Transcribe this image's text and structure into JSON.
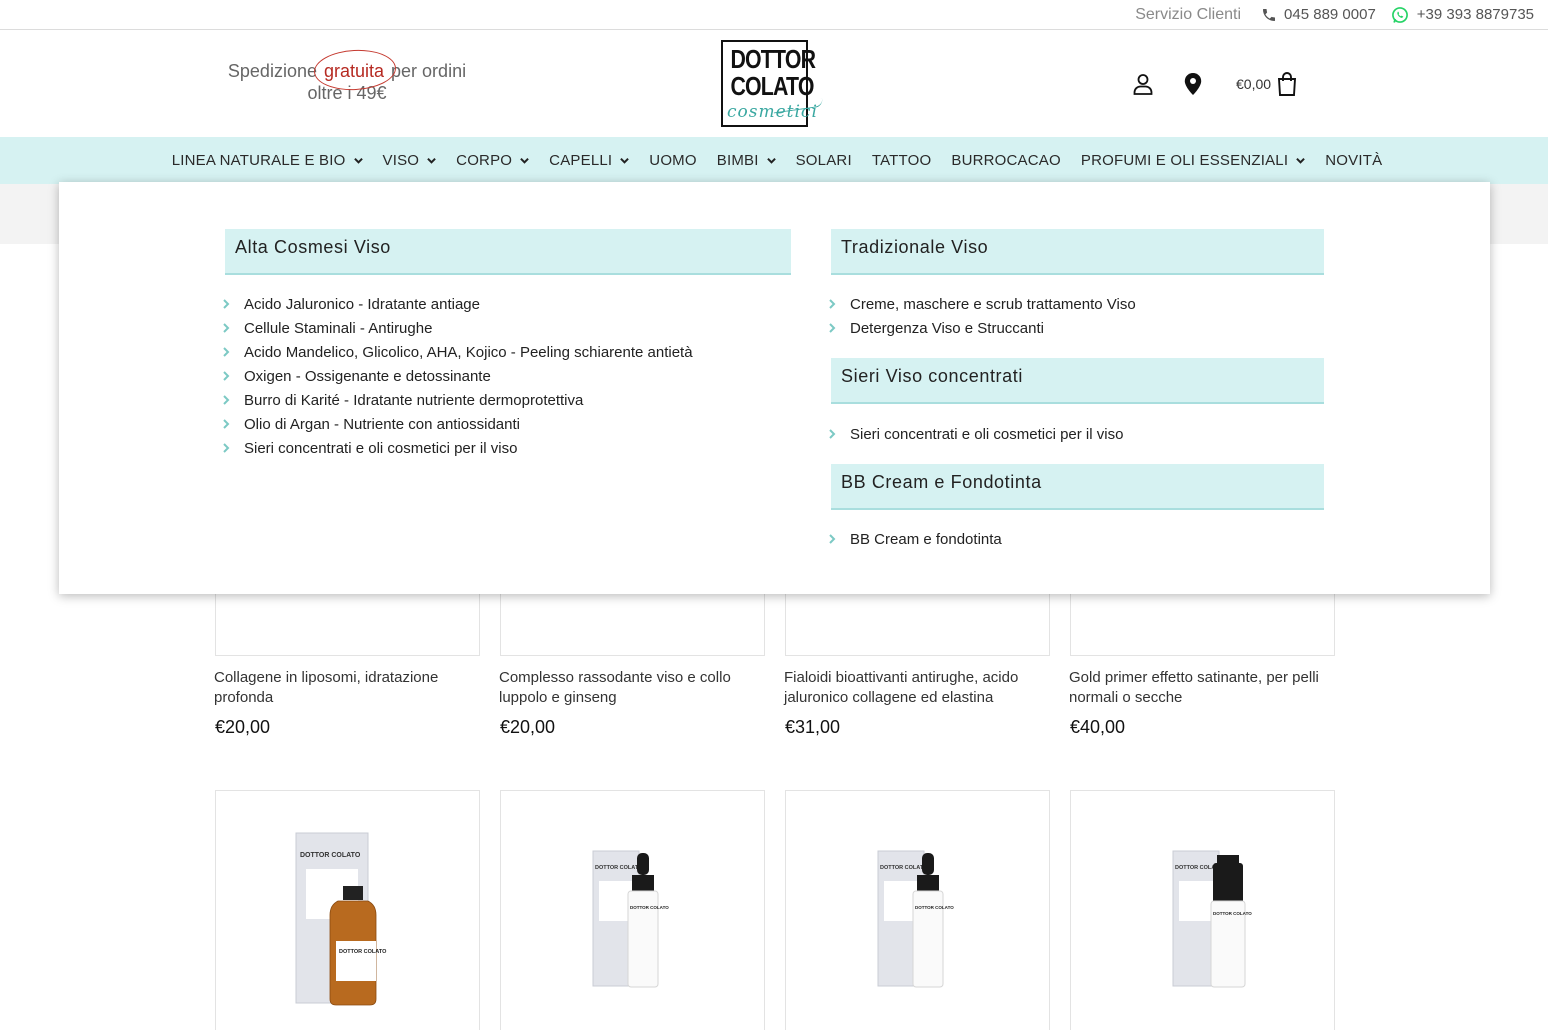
{
  "topbar": {
    "service_label": "Servizio Clienti",
    "phone": "045 889 0007",
    "whatsapp": "+39 393 8879735"
  },
  "header": {
    "promo_before": "Spedizione ",
    "promo_highlight": "gratuita",
    "promo_after": " per ordini oltre i 49€",
    "logo_line1": "DOTTOR",
    "logo_line2": "COLATO",
    "logo_script": "cosmetici",
    "cart_total": "€0,00"
  },
  "nav": {
    "items": [
      {
        "label": "LINEA NATURALE E BIO",
        "dropdown": true
      },
      {
        "label": "VISO",
        "dropdown": true
      },
      {
        "label": "CORPO",
        "dropdown": true
      },
      {
        "label": "CAPELLI",
        "dropdown": true
      },
      {
        "label": "UOMO",
        "dropdown": false
      },
      {
        "label": "BIMBI",
        "dropdown": true
      },
      {
        "label": "SOLARI",
        "dropdown": false
      },
      {
        "label": "TATTOO",
        "dropdown": false
      },
      {
        "label": "BURROCACAO",
        "dropdown": false
      },
      {
        "label": "PROFUMI E OLI ESSENZIALI",
        "dropdown": true
      },
      {
        "label": "NOVITÀ",
        "dropdown": false
      }
    ]
  },
  "mega": {
    "alta": {
      "title": "Alta Cosmesi Viso",
      "items": [
        "Acido Jaluronico - Idratante antiage",
        "Cellule Staminali - Antirughe",
        "Acido Mandelico, Glicolico, AHA, Kojico - Peeling schiarente antietà",
        "Oxigen - Ossigenante e detossinante",
        "Burro di Karité - Idratante nutriente dermoprotettiva",
        "Olio di Argan - Nutriente con antiossidanti",
        "Sieri concentrati e oli cosmetici per il viso"
      ]
    },
    "tradizionale": {
      "title": "Tradizionale Viso",
      "items": [
        "Creme, maschere e scrub trattamento Viso",
        "Detergenza Viso e Struccanti"
      ]
    },
    "sieri": {
      "title": "Sieri Viso concentrati",
      "items": [
        "Sieri concentrati e oli cosmetici per il viso"
      ]
    },
    "bb": {
      "title": "BB Cream e Fondotinta",
      "items": [
        "BB Cream e fondotinta"
      ]
    }
  },
  "products": [
    {
      "name": "Collagene in liposomi, idratazione profonda",
      "price": "€20,00"
    },
    {
      "name": "Complesso rassodante viso e collo luppolo e ginseng",
      "price": "€20,00"
    },
    {
      "name": "Fialoidi bioattivanti antirughe, acido jaluronico collagene ed elastina",
      "price": "€31,00"
    },
    {
      "name": "Gold primer effetto satinante, per pelli normali o secche",
      "price": "€40,00"
    }
  ],
  "product_images": {
    "brand_label": "DOTTOR COLATO"
  },
  "colors": {
    "accent_mint": "#d6f2f2",
    "accent_border": "#a9dede",
    "highlight_red": "#b62a22",
    "chevron_teal": "#7cc9c4",
    "whatsapp_green": "#25d366"
  }
}
